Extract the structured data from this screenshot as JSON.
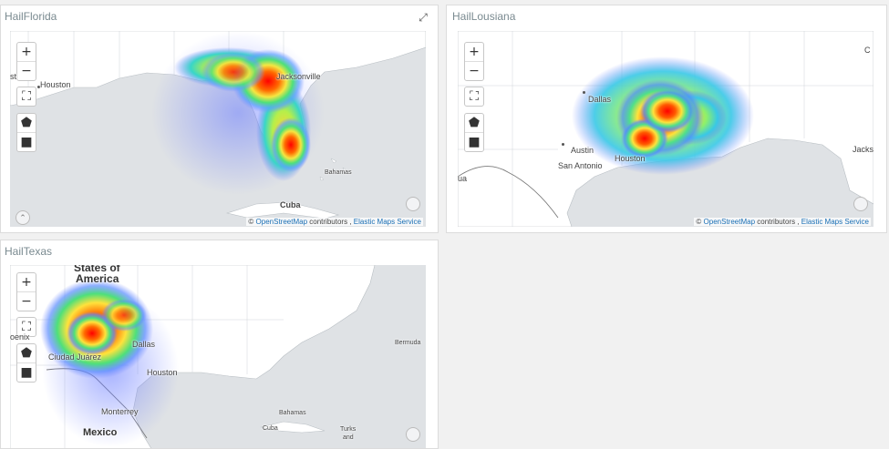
{
  "panels": {
    "florida": {
      "title": "HailFlorida",
      "labels": {
        "houston": "Houston",
        "jacksonville": "Jacksonville",
        "bahamas": "Bahamas",
        "cuba": "Cuba",
        "st": "st"
      },
      "attribution": {
        "osm": "OpenStreetMap",
        "contrib": "contributors ,",
        "ems": "Elastic Maps Service",
        "copy": "©"
      }
    },
    "louisiana": {
      "title": "HailLousiana",
      "labels": {
        "dallas": "Dallas",
        "austin": "Austin",
        "san_antonio": "San Antonio",
        "houston": "Houston",
        "jacks": "Jacks",
        "ua": "ua",
        "c": "C"
      },
      "attribution": {
        "osm": "OpenStreetMap",
        "contrib": "contributors ,",
        "ems": "Elastic Maps Service",
        "copy": "©"
      }
    },
    "texas": {
      "title": "HailTexas",
      "labels": {
        "states_of": "States of",
        "america": "America",
        "oenix": "oenix",
        "ciudad_juarez": "Ciudad Juárez",
        "dallas": "Dallas",
        "houston": "Houston",
        "monterrey": "Monterrey",
        "mexico": "Mexico",
        "bahamas": "Bahamas",
        "cuba": "Cuba",
        "turks": "Turks",
        "and": "and",
        "bermuda": "Bermuda"
      }
    }
  },
  "controls": {
    "zoom_in": "+",
    "zoom_out": "−",
    "fit": "⛶",
    "draw_polygon": "⬟",
    "draw_rect": "■"
  },
  "icons": {
    "expand": "expand-icon",
    "zoom_in": "plus-icon",
    "zoom_out": "minus-icon"
  },
  "colors": {
    "page_bg": "#f1f1f1",
    "panel_bg": "#ffffff",
    "water": "#dfe2e5",
    "land": "#ffffff",
    "title": "#7a8a90",
    "link": "#1a6fb5"
  }
}
